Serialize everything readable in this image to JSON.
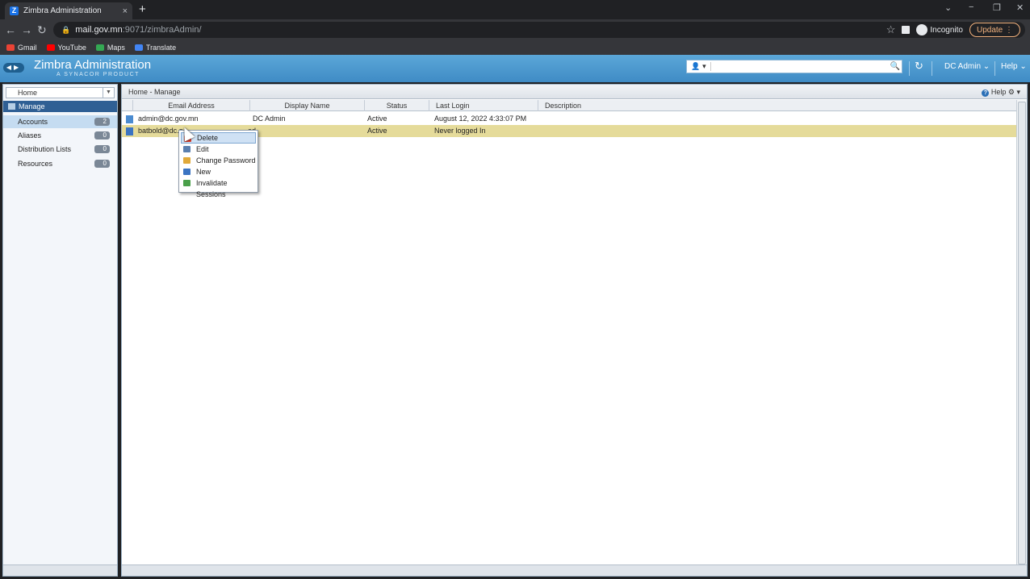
{
  "browser": {
    "tab_title": "Zimbra Administration",
    "tab_favicon": "Z",
    "tab_close": "×",
    "new_tab": "+",
    "url_host": "mail.gov.mn",
    "url_path": ":9071/zimbraAdmin/",
    "incognito_label": "Incognito",
    "update_label": "Update",
    "bookmarks": [
      {
        "label": "Gmail",
        "color": "#ea4335"
      },
      {
        "label": "YouTube",
        "color": "#ff0000"
      },
      {
        "label": "Maps",
        "color": "#34a853"
      },
      {
        "label": "Translate",
        "color": "#4285f4"
      }
    ]
  },
  "app": {
    "title": "Zimbra Administration",
    "subtitle": "A SYNACOR PRODUCT",
    "search_value": "",
    "user": "DC Admin",
    "help": "Help"
  },
  "sidebar": {
    "home": "Home",
    "section": "Manage",
    "items": [
      {
        "label": "Accounts",
        "count": "2",
        "selected": true
      },
      {
        "label": "Aliases",
        "count": "0",
        "selected": false
      },
      {
        "label": "Distribution Lists",
        "count": "0",
        "selected": false
      },
      {
        "label": "Resources",
        "count": "0",
        "selected": false
      }
    ]
  },
  "main": {
    "breadcrumb": "Home - Manage",
    "help": "Help",
    "columns": [
      "Email Address",
      "Display Name",
      "Status",
      "Last Login",
      "Description"
    ],
    "rows": [
      {
        "email": "admin@dc.gov.mn",
        "display_name": "DC Admin",
        "status": "Active",
        "last_login": "August 12, 2022 4:33:07 PM",
        "description": ""
      },
      {
        "email": "batbold@dc.g",
        "display_name": "od",
        "status": "Active",
        "last_login": "Never logged In",
        "description": ""
      }
    ]
  },
  "context_menu": {
    "items": [
      {
        "label": "Delete",
        "icon": "delete-icon",
        "color": "#d23b2b"
      },
      {
        "label": "Edit",
        "icon": "edit-icon",
        "color": "#5a7fb0"
      },
      {
        "label": "Change Password",
        "icon": "lock-icon",
        "color": "#e0a93a"
      },
      {
        "label": "New",
        "icon": "new-user-icon",
        "color": "#3b74c2"
      },
      {
        "label": "Invalidate Sessions",
        "icon": "invalidate-sessions-icon",
        "color": "#4aa04a"
      }
    ]
  }
}
